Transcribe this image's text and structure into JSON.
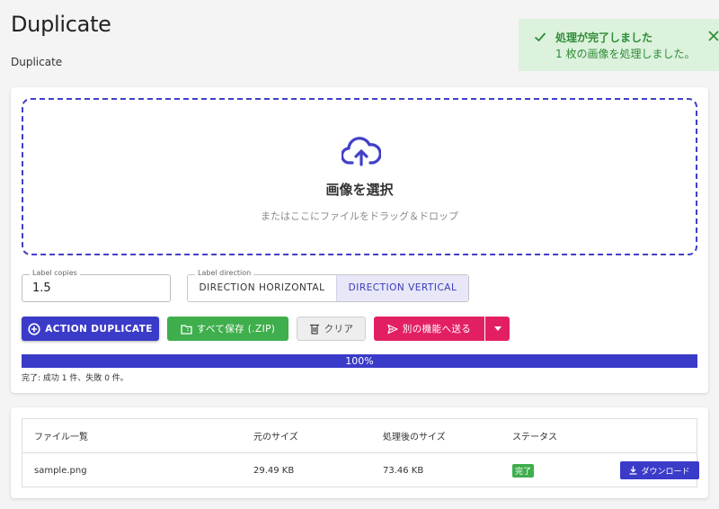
{
  "page": {
    "title": "Duplicate",
    "subtitle": "Duplicate"
  },
  "toast": {
    "title": "処理が完了しました",
    "message": "1 枚の画像を処理しました。",
    "color": "#2e8b36",
    "background": "#dcf2dd"
  },
  "dropzone": {
    "title": "画像を選択",
    "hint": "またはここにファイルをドラッグ＆ドロップ",
    "icon": "cloud-upload-icon",
    "accent": "#4040c8"
  },
  "controls": {
    "copies_label": "Label copies",
    "copies_value": "1.5",
    "direction_label": "Label direction",
    "direction_options": [
      "DIRECTION HORIZONTAL",
      "DIRECTION VERTICAL"
    ],
    "direction_selected": "DIRECTION VERTICAL"
  },
  "actions": {
    "duplicate": "ACTION DUPLICATE",
    "save_zip": "すべて保存 (.ZIP)",
    "clear": "クリア",
    "send": "別の機能へ送る"
  },
  "progress": {
    "label": "100%",
    "value": 1.0,
    "status": "完了: 成功 1 件、失敗 0 件。"
  },
  "files_table": {
    "headers": [
      "ファイル一覧",
      "元のサイズ",
      "処理後のサイズ",
      "ステータス"
    ],
    "rows": [
      {
        "name": "sample.png",
        "original_size": "29.49 KB",
        "processed_size": "73.46 KB",
        "status": "完了",
        "download": "ダウンロード"
      }
    ]
  },
  "colors": {
    "primary": "#3b3bc9",
    "success": "#3fae4c",
    "danger": "#e31f64"
  }
}
